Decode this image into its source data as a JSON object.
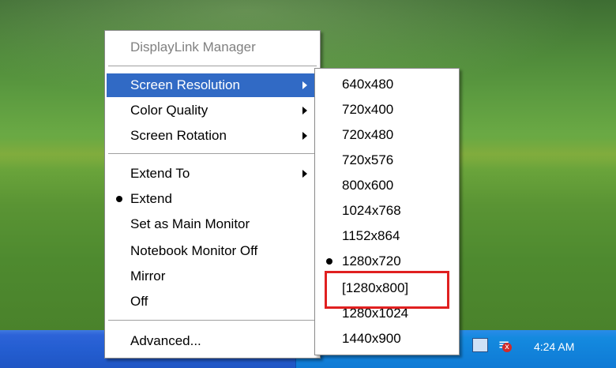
{
  "menu": {
    "title": "DisplayLink Manager",
    "items": {
      "screen_resolution": "Screen Resolution",
      "color_quality": "Color Quality",
      "screen_rotation": "Screen Rotation",
      "extend_to": "Extend To",
      "extend": "Extend",
      "set_main": "Set as Main Monitor",
      "notebook_off": "Notebook Monitor Off",
      "mirror": "Mirror",
      "off": "Off",
      "advanced": "Advanced..."
    },
    "selected_mode": "Extend",
    "highlighted_item": "Screen Resolution"
  },
  "resolution_submenu": {
    "options": [
      "640x480",
      "720x400",
      "720x480",
      "720x576",
      "800x600",
      "1024x768",
      "1152x864",
      "1280x720",
      "[1280x800]",
      "1280x1024",
      "1440x900"
    ],
    "current": "1280x720",
    "highlight_callout": "[1280x800]",
    "callout_color": "#e02020"
  },
  "taskbar": {
    "clock": "4:24 AM",
    "tray_icons": [
      "app-icon",
      "security-alert-icon",
      "network-x-icon",
      "red-x-icon",
      "tool-icon",
      "shield-icon",
      "monitor-icon",
      "wireless-disconnected-icon"
    ]
  },
  "colors": {
    "menu_highlight": "#316ac5",
    "taskbar_blue": "#245ed1"
  }
}
